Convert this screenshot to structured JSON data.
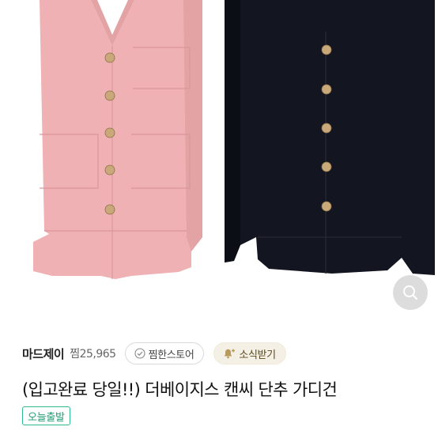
{
  "product": {
    "title": "(입고완료 당일!!) 더베이지스 캔씨 단추 가디건",
    "badge": "오늘출발",
    "images": [
      {
        "color_name": "pink",
        "body_color": "#efb1b3",
        "shade_color": "#e3a2a4"
      },
      {
        "color_name": "black",
        "body_color": "#131620",
        "shade_color": "#0c0e15"
      }
    ],
    "button_color": "#c9a87a"
  },
  "store": {
    "name": "마드제이",
    "likes": "찜25,965",
    "follow_label": "찜한스토어",
    "news_label": "소식받기"
  },
  "icons": {
    "zoom": "magnifier-icon",
    "follow": "check-icon",
    "news": "bell-plus-icon"
  }
}
